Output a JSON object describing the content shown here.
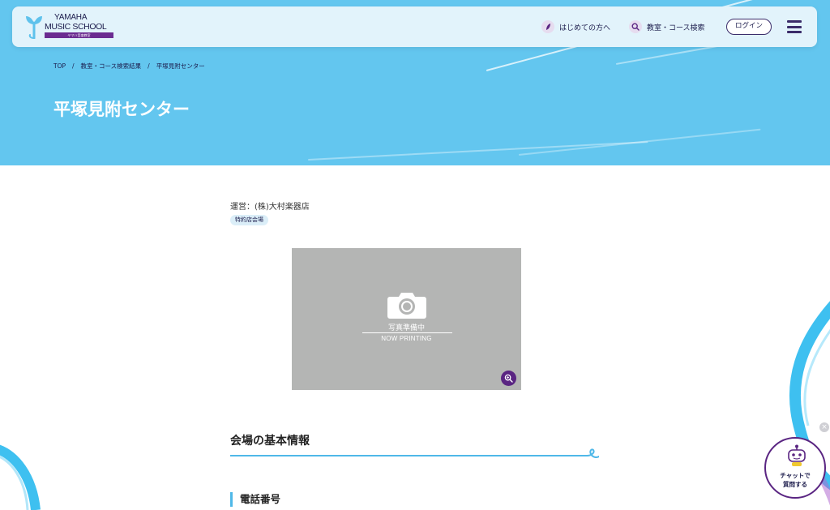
{
  "brand": {
    "line1": "YAMAHA",
    "line2": "MUSIC SCHOOL",
    "sub": "ヤマハ音楽教室"
  },
  "nav": {
    "beginners": "はじめての方へ",
    "search": "教室・コース検索",
    "login": "ログイン"
  },
  "breadcrumb": {
    "items": [
      "TOP",
      "教室・コース検索結果",
      "平塚見附センター"
    ],
    "separator": "/"
  },
  "page": {
    "title": "平塚見附センター",
    "operator": "運営：(株)大村楽器店",
    "tag": "特約店会場"
  },
  "photo": {
    "placeholder_ja": "写真準備中",
    "placeholder_en": "NOW PRINTING"
  },
  "sections": {
    "basic_info": "会場の基本情報",
    "phone": "電話番号"
  },
  "chat": {
    "line1": "チャットで",
    "line2": "質問する",
    "close": "×"
  },
  "colors": {
    "hero": "#63c6ef",
    "accent_purple": "#5a2582",
    "navy": "#1b1b4b",
    "accent_blue": "#4fb8e8"
  },
  "icons": {
    "beginners": "leaf-icon",
    "search": "search-icon",
    "menu": "hamburger-icon",
    "zoom": "zoom-in-icon",
    "camera": "camera-icon",
    "chat": "robot-icon"
  }
}
